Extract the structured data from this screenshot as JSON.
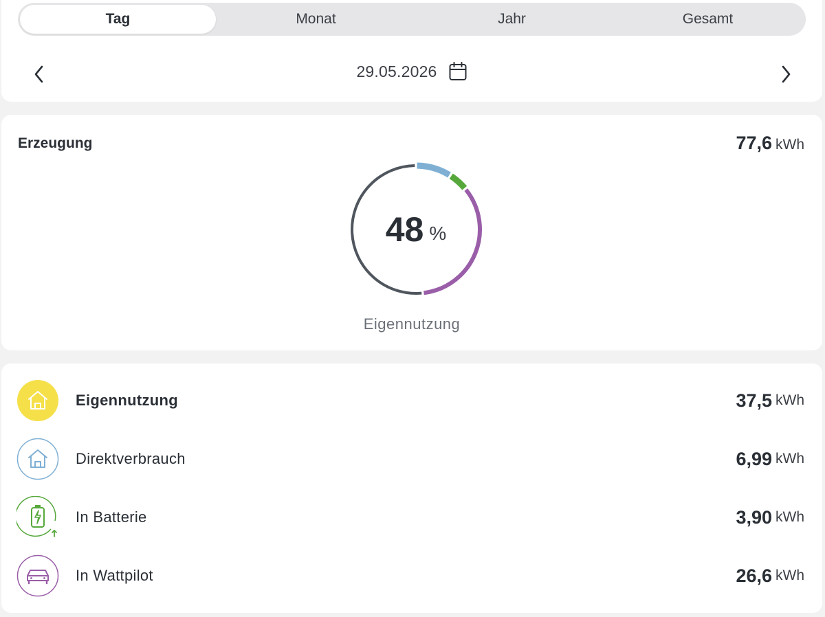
{
  "period_tabs": [
    "Tag",
    "Monat",
    "Jahr",
    "Gesamt"
  ],
  "active_tab": "Tag",
  "date": "29.05.2026",
  "generation": {
    "title": "Erzeugung",
    "total_value": "77,6",
    "total_unit": "kWh",
    "self_use_percent": "48",
    "percent_unit": "%",
    "donut_label": "Eigennutzung"
  },
  "chart_data": {
    "type": "pie",
    "categories": [
      "Eigennutzung",
      "Direktverbrauch",
      "In Batterie",
      "In Wattpilot"
    ],
    "values": [
      37.5,
      6.99,
      3.9,
      26.6
    ],
    "total": 77.6
  },
  "breakdown": [
    {
      "label": "Eigennutzung",
      "value": "37,5",
      "unit": "kWh",
      "icon": "house-icon",
      "color": "#f5e04a"
    },
    {
      "label": "Direktverbrauch",
      "value": "6,99",
      "unit": "kWh",
      "icon": "house-outline-icon",
      "color": "#7fb0d4"
    },
    {
      "label": "In Batterie",
      "value": "3,90",
      "unit": "kWh",
      "icon": "battery-charging-icon",
      "color": "#56a83b"
    },
    {
      "label": "In Wattpilot",
      "value": "26,6",
      "unit": "kWh",
      "icon": "car-icon",
      "color": "#9a5ea8"
    }
  ],
  "colors": {
    "self_use": "#f5e04a",
    "direct": "#7fb0d4",
    "battery": "#56a83b",
    "wattpilot": "#9a5ea8",
    "rest": "#50565e"
  }
}
